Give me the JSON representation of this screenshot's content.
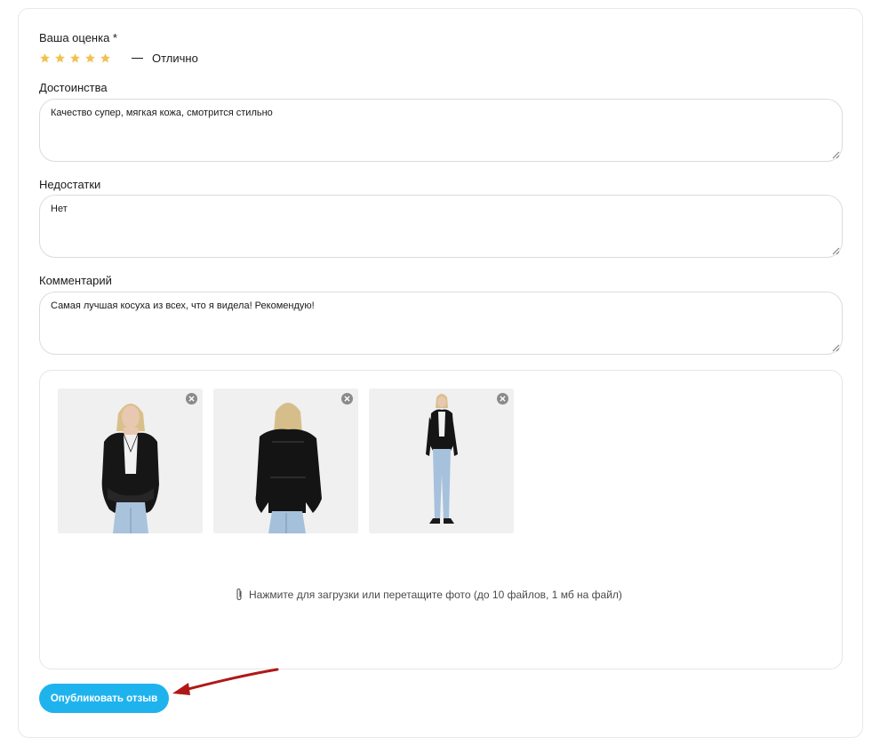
{
  "rating": {
    "label": "Ваша оценка *",
    "value": 5,
    "max": 5,
    "text": "Отлично",
    "star_color": "#f2c14e"
  },
  "pros": {
    "label": "Достоинства",
    "value": "Качество супер, мягкая кожа, смотрится стильно"
  },
  "cons": {
    "label": "Недостатки",
    "value": "Нет"
  },
  "comment": {
    "label": "Комментарий",
    "value": "Самая лучшая косуха из всех, что я видела! Рекомендую!"
  },
  "photos": {
    "items": [
      {
        "view": "front"
      },
      {
        "view": "back"
      },
      {
        "view": "full-length"
      }
    ],
    "remove_icon": "close-circle-icon",
    "upload_icon": "paperclip-icon",
    "upload_hint": "Нажмите для загрузки или перетащите фото (до 10 файлов, 1 мб на файл)"
  },
  "submit": {
    "label": "Опубликовать отзыв",
    "color": "#1fb3ee"
  },
  "annotation": {
    "arrow_color": "#b01818"
  }
}
